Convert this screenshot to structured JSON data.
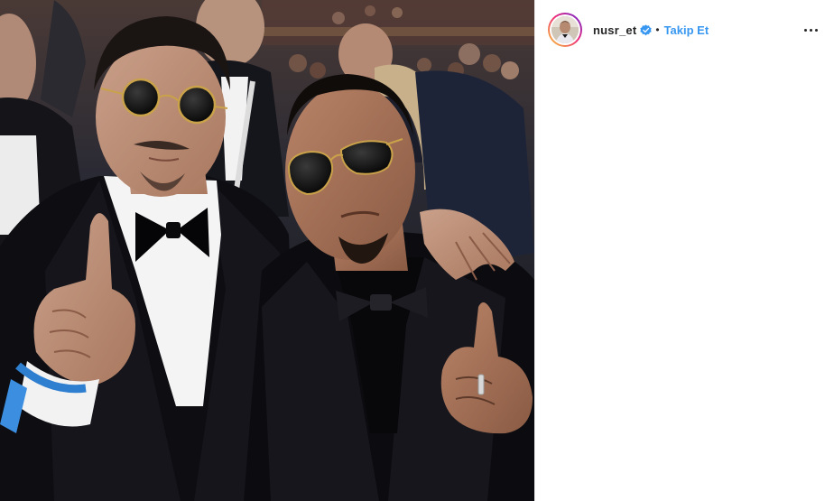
{
  "post": {
    "photo": {
      "description_icon": "photo-icon"
    },
    "header": {
      "username": "nusr_et",
      "separator": "•",
      "follow_label": "Takip Et",
      "verified_icon": "verified-badge-icon",
      "more_icon": "more-options-icon"
    }
  },
  "colors": {
    "accent": "#3897f0",
    "text": "#262626",
    "verified": "#3897f0"
  }
}
